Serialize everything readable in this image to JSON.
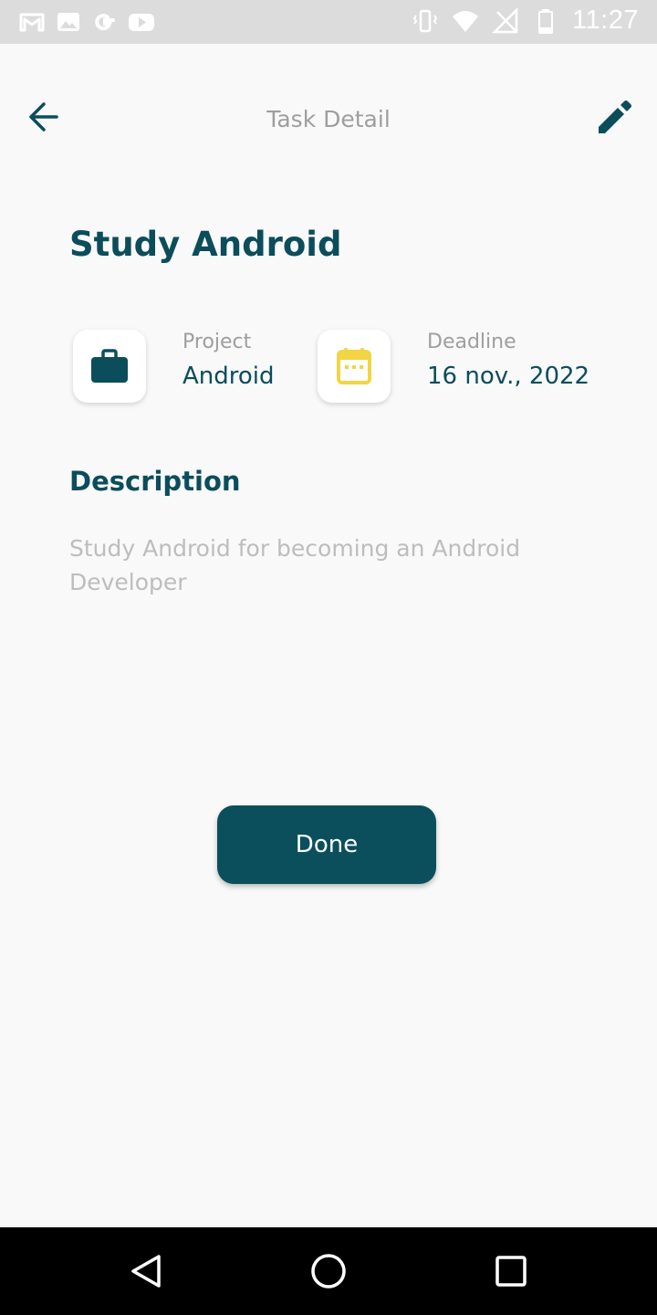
{
  "status_bar": {
    "time": "11:27",
    "left_icons": [
      "gmail-icon",
      "photos-icon",
      "google-icon",
      "youtube-icon"
    ],
    "right_icons": [
      "vibrate-icon",
      "wifi-icon",
      "no-signal-icon",
      "battery-icon"
    ]
  },
  "app_bar": {
    "title": "Task Detail",
    "back_icon": "arrow-left-icon",
    "edit_icon": "pencil-icon"
  },
  "task": {
    "title": "Study Android",
    "project_label": "Project",
    "project_value": "Android",
    "deadline_label": "Deadline",
    "deadline_value": "16 nov., 2022",
    "description_heading": "Description",
    "description_text": "Study Android for becoming an Android Developer",
    "done_label": "Done"
  },
  "colors": {
    "primary": "#0b4f5d",
    "accent_calendar": "#f2d544",
    "label_gray": "#9e9e9e",
    "description_gray": "#bdbdbd",
    "background": "#f9f9f9"
  },
  "nav_bar": {
    "icons": [
      "nav-back-icon",
      "nav-home-icon",
      "nav-recents-icon"
    ]
  }
}
